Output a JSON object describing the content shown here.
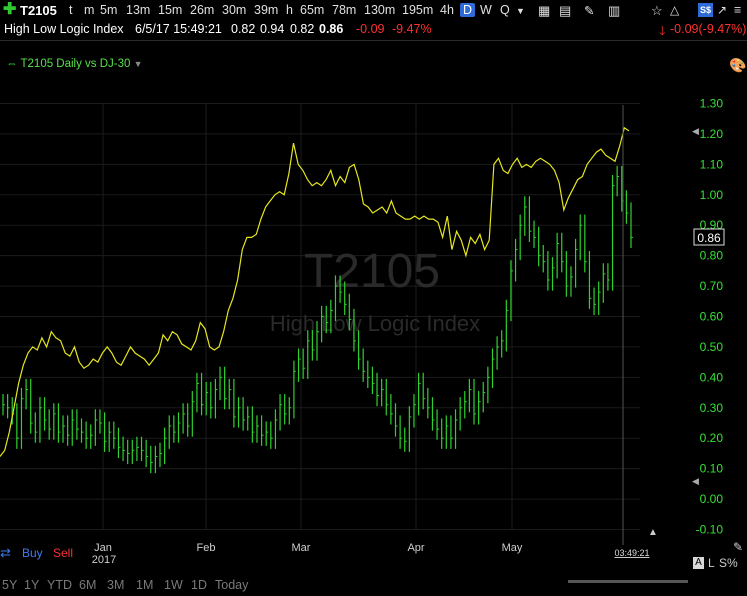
{
  "toolbar": {
    "symbol": "T2105",
    "timeframes": [
      "t",
      "m",
      "5m",
      "13m",
      "15m",
      "26m",
      "30m",
      "39m",
      "h",
      "65m",
      "78m",
      "130m",
      "195m",
      "4h",
      "D",
      "W",
      "Q"
    ],
    "active_timeframe": "D"
  },
  "quote": {
    "name": "High Low Logic Index",
    "datetime": "6/5/17 15:49:21",
    "open": "0.82",
    "high": "0.94",
    "low": "0.82",
    "last": "0.86",
    "change": "-0.09",
    "change_pct": "-9.47%",
    "right_change": "-0.09(-9.47%)"
  },
  "study_label": "T2105 Daily vs DJ-30",
  "watermark": {
    "symbol": "T2105",
    "name": "High Low Logic Index"
  },
  "buttons": {
    "buy": "Buy",
    "sell": "Sell"
  },
  "time_label": "03:49:21",
  "bottom_right": {
    "a": "A",
    "l": "L",
    "s": "S%"
  },
  "periods": [
    "5Y",
    "1Y",
    "YTD",
    "6M",
    "3M",
    "1M",
    "1W",
    "1D",
    "Today"
  ],
  "colors": {
    "bars": "#2fd12f",
    "line": "#e6e61e",
    "axis_text": "#34e034",
    "negative": "#ff3030",
    "active_tab": "#2f6bd8"
  },
  "chart_data": {
    "type": "line",
    "title": "T2105 Daily vs DJ-30",
    "ylim": [
      -0.1,
      1.3
    ],
    "yticks": [
      "1.30",
      "1.20",
      "1.10",
      "1.00",
      "0.90",
      "0.80",
      "0.70",
      "0.60",
      "0.50",
      "0.40",
      "0.30",
      "0.20",
      "0.10",
      "0.00",
      "-0.10"
    ],
    "xticks": [
      "Jan",
      "Feb",
      "Mar",
      "Apr",
      "May"
    ],
    "year_label": "2017",
    "last_value_label": "0.86",
    "series": [
      {
        "type": "bar",
        "values": [
          0.31,
          0.3,
          0.28,
          0.2,
          0.33,
          0.36,
          0.25,
          0.22,
          0.3,
          0.26,
          0.23,
          0.28,
          0.22,
          0.24,
          0.21,
          0.26,
          0.23,
          0.22,
          0.2,
          0.21,
          0.26,
          0.25,
          0.19,
          0.22,
          0.2,
          0.17,
          0.16,
          0.15,
          0.16,
          0.17,
          0.16,
          0.14,
          0.12,
          0.14,
          0.15,
          0.2,
          0.24,
          0.22,
          0.25,
          0.28,
          0.24,
          0.32,
          0.38,
          0.31,
          0.35,
          0.3,
          0.36,
          0.4,
          0.33,
          0.36,
          0.27,
          0.3,
          0.26,
          0.27,
          0.22,
          0.24,
          0.21,
          0.22,
          0.2,
          0.26,
          0.31,
          0.28,
          0.3,
          0.42,
          0.46,
          0.43,
          0.52,
          0.49,
          0.55,
          0.6,
          0.58,
          0.62,
          0.7,
          0.68,
          0.64,
          0.59,
          0.52,
          0.46,
          0.42,
          0.4,
          0.38,
          0.34,
          0.36,
          0.31,
          0.28,
          0.24,
          0.2,
          0.19,
          0.27,
          0.31,
          0.38,
          0.33,
          0.3,
          0.26,
          0.23,
          0.2,
          0.24,
          0.2,
          0.26,
          0.3,
          0.32,
          0.36,
          0.28,
          0.32,
          0.35,
          0.4,
          0.46,
          0.5,
          0.52,
          0.62,
          0.75,
          0.82,
          0.9,
          0.96,
          0.88,
          0.86,
          0.8,
          0.78,
          0.72,
          0.76,
          0.84,
          0.78,
          0.7,
          0.73,
          0.82,
          0.9,
          0.78,
          0.66,
          0.64,
          0.68,
          0.74,
          0.72,
          1.03,
          1.06,
          0.98,
          0.94,
          0.86
        ]
      },
      {
        "type": "line",
        "values": [
          0.14,
          0.16,
          0.22,
          0.3,
          0.38,
          0.44,
          0.48,
          0.5,
          0.49,
          0.53,
          0.5,
          0.55,
          0.53,
          0.52,
          0.48,
          0.47,
          0.5,
          0.45,
          0.43,
          0.44,
          0.46,
          0.45,
          0.48,
          0.5,
          0.48,
          0.45,
          0.44,
          0.47,
          0.5,
          0.48,
          0.47,
          0.46,
          0.44,
          0.46,
          0.48,
          0.54,
          0.52,
          0.55,
          0.54,
          0.51,
          0.5,
          0.49,
          0.52,
          0.58,
          0.56,
          0.5,
          0.49,
          0.5,
          0.55,
          0.62,
          0.66,
          0.72,
          0.82,
          0.86,
          0.86,
          0.87,
          0.92,
          0.96,
          0.98,
          1.0,
          1.01,
          1.0,
          1.07,
          1.17,
          1.1,
          1.08,
          1.05,
          1.03,
          1.04,
          1.03,
          1.05,
          1.08,
          1.03,
          1.06,
          1.04,
          1.09,
          1.1,
          1.05,
          0.97,
          0.96,
          0.94,
          0.95,
          0.96,
          0.94,
          0.98,
          0.94,
          0.93,
          0.92,
          0.92,
          0.93,
          0.92,
          0.93,
          0.92,
          0.92,
          0.91,
          0.86,
          0.93,
          0.82,
          0.88,
          0.85,
          0.8,
          0.86,
          0.84,
          0.87,
          0.82,
          0.85,
          1.1,
          1.12,
          1.08,
          1.07,
          1.1,
          1.12,
          1.09,
          1.1,
          1.09,
          1.11,
          1.12,
          1.11,
          1.1,
          1.08,
          1.04,
          0.95,
          0.99,
          1.02,
          1.05,
          1.06,
          1.1,
          1.12,
          1.14,
          1.15,
          1.13,
          1.12,
          1.11,
          1.16,
          1.22,
          1.21
        ]
      }
    ]
  }
}
